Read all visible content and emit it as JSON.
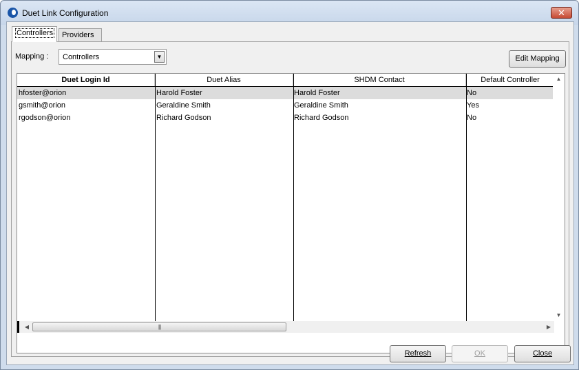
{
  "window": {
    "title": "Duet Link Configuration",
    "close_glyph": "✕"
  },
  "tabs": [
    {
      "label": "Controllers",
      "active": true
    },
    {
      "label": "Providers",
      "active": false
    }
  ],
  "mapping": {
    "label": "Mapping :",
    "value": "Controllers"
  },
  "buttons": {
    "edit_mapping": "Edit Mapping",
    "refresh": "Refresh",
    "ok": "OK",
    "close": "Close"
  },
  "table": {
    "columns": [
      "Duet Login Id",
      "Duet Alias",
      "SHDM Contact",
      "Default Controller"
    ],
    "rows": [
      [
        "hfoster@orion",
        "Harold Foster",
        "Harold Foster",
        "No"
      ],
      [
        "gsmith@orion",
        "Geraldine Smith",
        "Geraldine Smith",
        "Yes"
      ],
      [
        "rgodson@orion",
        "Richard Godson",
        "Richard Godson",
        "No"
      ]
    ],
    "selected_row": 0
  },
  "icons": {
    "app": "duet-app-icon",
    "close": "close-icon",
    "dropdown": "chevron-down-icon",
    "scroll_up": "scroll-up-icon",
    "scroll_down": "scroll-down-icon",
    "scroll_left": "scroll-left-icon",
    "scroll_right": "scroll-right-icon"
  }
}
